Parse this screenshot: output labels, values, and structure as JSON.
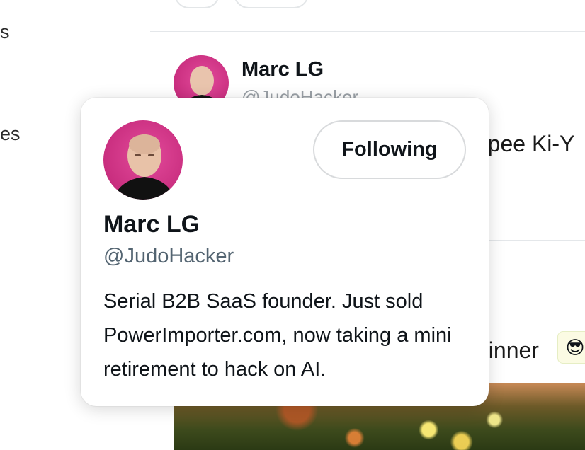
{
  "sidebar": {
    "items": [
      {
        "label": "s"
      },
      {
        "label": "es"
      }
    ]
  },
  "post": {
    "author_name": "Marc LG",
    "author_handle": "@JudoHacker",
    "text_fragment": "-pee Ki-Y"
  },
  "post2": {
    "text_fragment": "dinner",
    "emoji": "😎"
  },
  "hover_card": {
    "name": "Marc LG",
    "handle": "@JudoHacker",
    "follow_button_label": "Following",
    "bio": "Serial B2B SaaS founder. Just sold PowerImporter.com, now taking a mini retirement to hack on AI."
  },
  "colors": {
    "avatar_background": "#c92e7f",
    "handle_text": "#536471",
    "divider": "#e4e7ea"
  }
}
